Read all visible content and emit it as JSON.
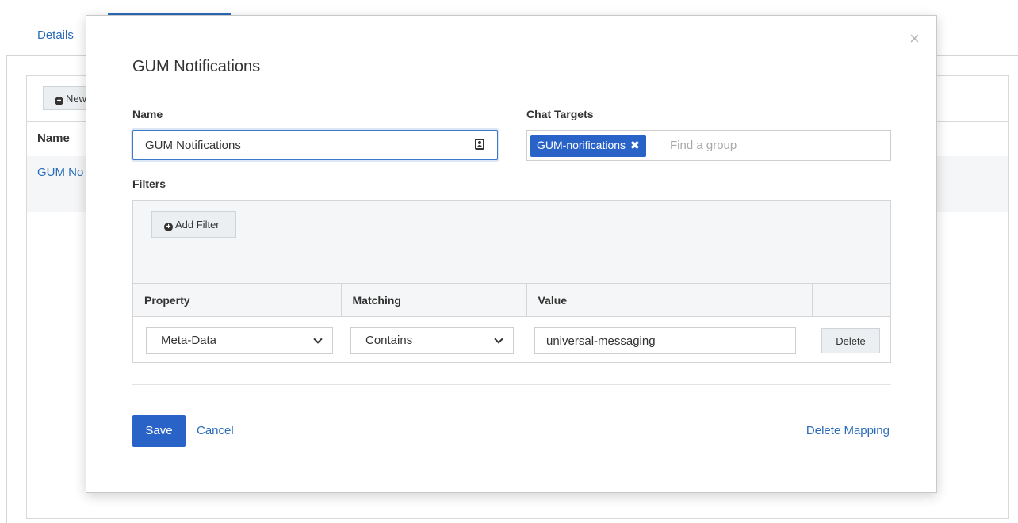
{
  "background": {
    "tab_label": "Details",
    "new_button_label": "New",
    "name_column_header": "Name",
    "row_link": "GUM No"
  },
  "modal": {
    "title": "GUM Notifications",
    "close_label": "×",
    "name_label": "Name",
    "name_value": "GUM Notifications",
    "chat_targets_label": "Chat Targets",
    "chat_tag": "GUM-norifications",
    "chat_tag_remove": "✖",
    "chat_placeholder": "Find a group",
    "filters_label": "Filters",
    "add_filter_label": "Add Filter",
    "filter_columns": [
      "Property",
      "Matching",
      "Value",
      ""
    ],
    "filter_row": {
      "property": "Meta-Data",
      "matching": "Contains",
      "value": "universal-messaging",
      "delete_label": "Delete"
    },
    "save_label": "Save",
    "cancel_label": "Cancel",
    "delete_mapping_label": "Delete Mapping"
  }
}
